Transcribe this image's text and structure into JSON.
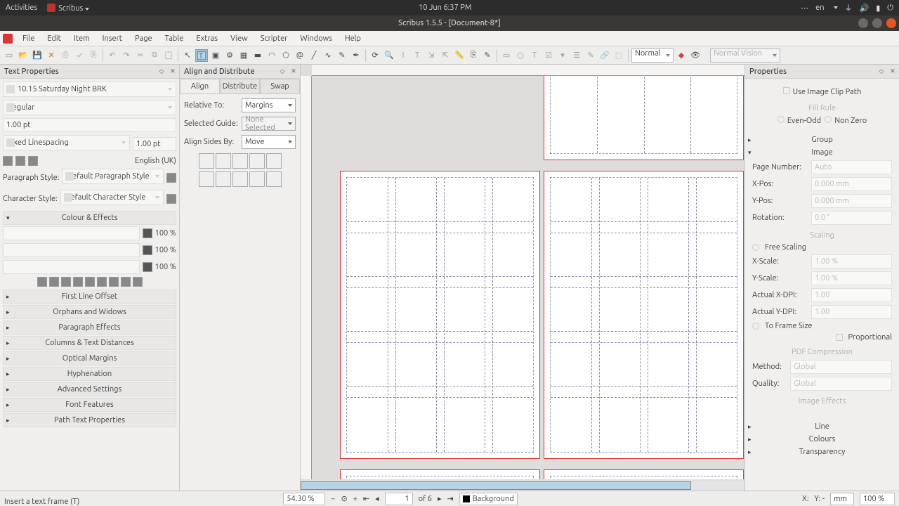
{
  "topbar": {
    "activities": "Activities",
    "app": "Scribus",
    "datetime": "10 Jun   6:37 PM",
    "lang": "en"
  },
  "window": {
    "title": "Scribus 1.5.5 - [Document-8*]"
  },
  "menu": [
    "File",
    "Edit",
    "Item",
    "Insert",
    "Page",
    "Table",
    "Extras",
    "View",
    "Scripter",
    "Windows",
    "Help"
  ],
  "toolbar": {
    "display_mode": "Normal",
    "vision": "Normal Vision"
  },
  "textprops": {
    "title": "Text Properties",
    "font": "10.15 Saturday Night BRK",
    "style": "Regular",
    "size": "1.00 pt",
    "linespacing_mode": "Fixed Linespacing",
    "linespacing_value": "1.00 pt",
    "language": "English (UK)",
    "para_style_label": "Paragraph Style:",
    "para_style": "Default Paragraph Style",
    "char_style_label": "Character Style:",
    "char_style": "Default Character Style",
    "sections": [
      "Colour & Effects",
      "First Line Offset",
      "Orphans and Widows",
      "Paragraph Effects",
      "Columns & Text Distances",
      "Optical Margins",
      "Hyphenation",
      "Advanced Settings",
      "Font Features",
      "Path Text Properties"
    ],
    "swatch_pct": "100 %"
  },
  "align": {
    "title": "Align and Distribute",
    "tabs": [
      "Align",
      "Distribute",
      "Swap"
    ],
    "relative_to_label": "Relative To:",
    "relative_to": "Margins",
    "selected_guide_label": "Selected Guide:",
    "selected_guide": "None Selected",
    "align_sides_label": "Align Sides By:",
    "align_sides": "Move"
  },
  "props": {
    "title": "Properties",
    "clip": "Use Image Clip Path",
    "fillrule": "Fill Rule",
    "even": "Even-Odd",
    "nonzero": "Non Zero",
    "group": "Group",
    "image": "Image",
    "pageno_label": "Page Number:",
    "pageno": "Auto",
    "xpos_label": "X-Pos:",
    "xpos": "0.000 mm",
    "ypos_label": "Y-Pos:",
    "ypos": "0.000 mm",
    "rot_label": "Rotation:",
    "rot": "0.0 °",
    "scaling": "Scaling",
    "freescale": "Free Scaling",
    "xs_label": "X-Scale:",
    "xs": "1.00 %",
    "ys_label": "Y-Scale:",
    "ys": "1.00 %",
    "axd_label": "Actual X-DPI:",
    "axd": "1.00",
    "ayd_label": "Actual Y-DPI:",
    "ayd": "1.00",
    "toframe": "To Frame Size",
    "prop": "Proportional",
    "pdf": "PDF Compression",
    "method_label": "Method:",
    "method": "Global",
    "quality_label": "Quality:",
    "quality": "Global",
    "fx": "Image Effects",
    "line": "Line",
    "colours": "Colours",
    "transp": "Transparency"
  },
  "status": {
    "hint": "Insert a text frame (T)",
    "zoom": "54.30 %",
    "page": "1",
    "of": "of 6",
    "layer": "Background",
    "x": "X:",
    "y": "Y: -",
    "unit": "mm",
    "zoom2": "100 %"
  }
}
